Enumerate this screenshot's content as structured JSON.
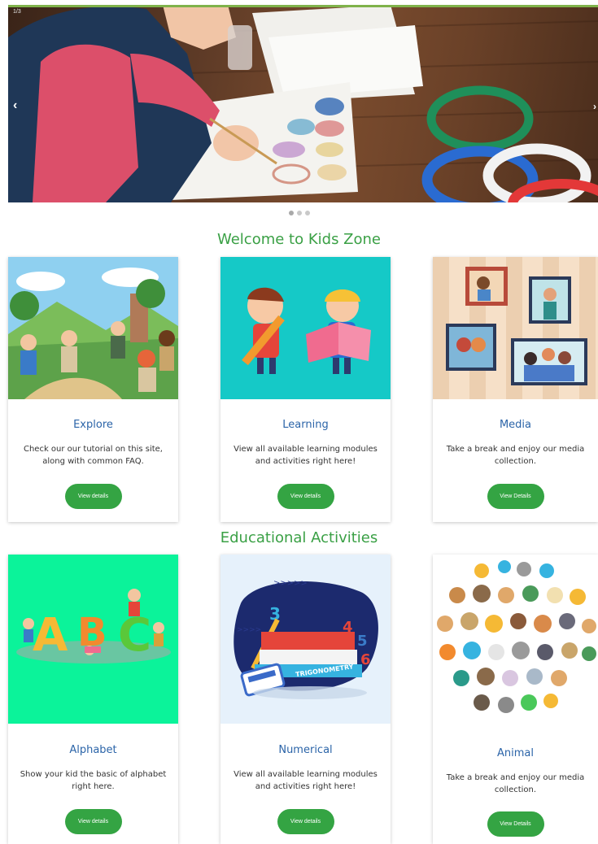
{
  "carousel": {
    "counter": "1/3",
    "prev_label": "‹",
    "next_label": "›",
    "slides": 3,
    "active_slide": 1
  },
  "sections": {
    "welcome_title": "Welcome to Kids Zone",
    "activities_title": "Educational Activities"
  },
  "cards": [
    {
      "title": "Explore",
      "description": "Check our our tutorial on this site, along with common FAQ.",
      "button": "View details"
    },
    {
      "title": "Learning",
      "description": "View all available learning modules and activities right here!",
      "button": "View details"
    },
    {
      "title": "Media",
      "description": "Take a break and enjoy our media collection.",
      "button": "View Details"
    },
    {
      "title": "Alphabet",
      "description": "Show your kid the basic of alphabet right here.",
      "button": "View details"
    },
    {
      "title": "Numerical",
      "description": "View all available learning modules and activities right here!",
      "button": "View details"
    },
    {
      "title": "Animal",
      "description": "Take a break and enjoy our media collection.",
      "button": "View Details"
    }
  ],
  "image_text": {
    "trigonometry": "TRIGONOMETRY"
  },
  "colors": {
    "accent_green": "#3aa045",
    "button_green": "#34a443",
    "title_blue": "#2b64a8"
  }
}
